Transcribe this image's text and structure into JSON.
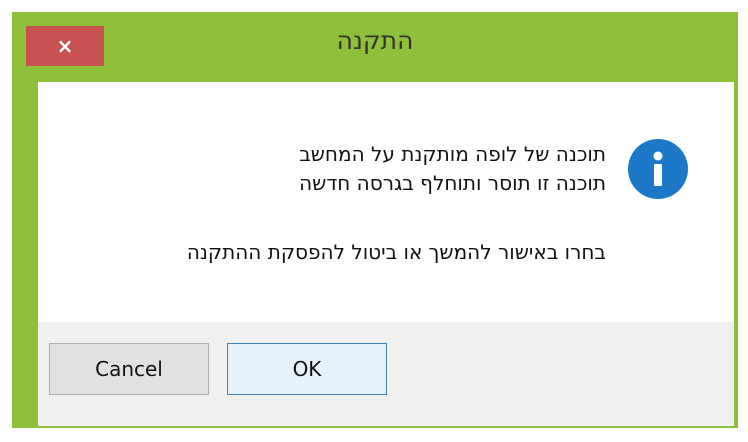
{
  "window": {
    "title": "התקנה",
    "close_label": "×",
    "frame_color": "#8fc03a"
  },
  "message": {
    "line1": "תוכנה של לופה מותקנת על המחשב",
    "line2": "תוכנה זו תוסר ותוחלף בגרסה חדשה",
    "prompt": "בחרו באישור להמשך או ביטול להפסקת ההתקנה",
    "icon": "info-icon"
  },
  "buttons": {
    "cancel_label": "Cancel",
    "ok_label": "OK"
  }
}
